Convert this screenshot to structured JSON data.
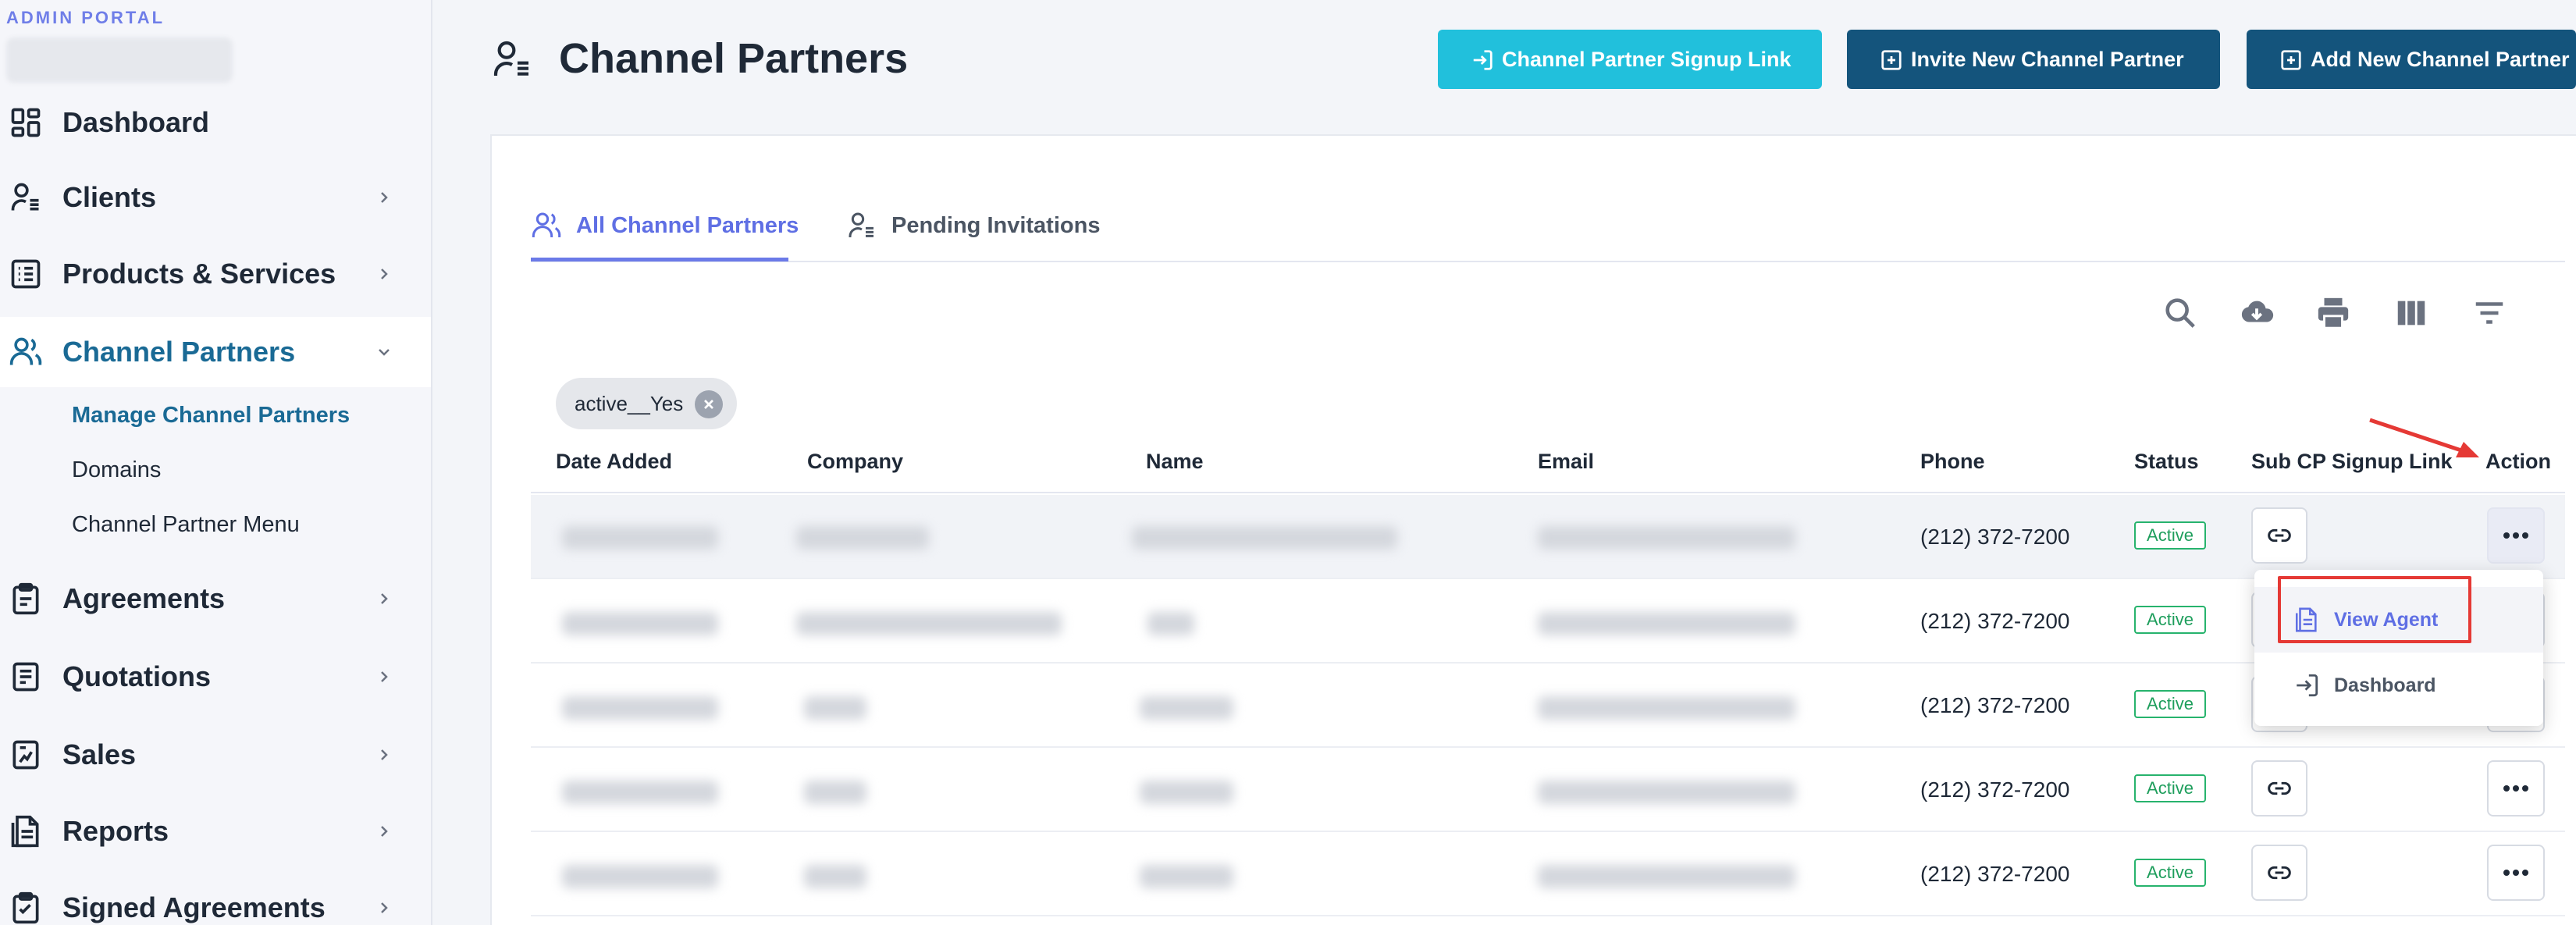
{
  "sidebar": {
    "brand": "ADMIN PORTAL",
    "items": [
      {
        "label": "Dashboard",
        "icon": "grid-icon"
      },
      {
        "label": "Clients",
        "icon": "user-list-icon"
      },
      {
        "label": "Products & Services",
        "icon": "list-icon"
      },
      {
        "label": "Channel Partners",
        "icon": "users-icon"
      },
      {
        "label": "Agreements",
        "icon": "clipboard-icon"
      },
      {
        "label": "Quotations",
        "icon": "receipt-icon"
      },
      {
        "label": "Sales",
        "icon": "sales-icon"
      },
      {
        "label": "Reports",
        "icon": "report-icon"
      },
      {
        "label": "Signed Agreements",
        "icon": "signed-icon"
      }
    ],
    "submenu": [
      "Manage Channel Partners",
      "Domains",
      "Channel Partner Menu"
    ]
  },
  "header": {
    "title": "Channel Partners",
    "buttons": {
      "signup_link": "Channel Partner Signup Link",
      "invite": "Invite New Channel Partner",
      "add": "Add New Channel Partner"
    }
  },
  "tabs": {
    "all": "All Channel Partners",
    "pending": "Pending Invitations"
  },
  "filter_chip": "active__Yes",
  "table": {
    "columns": [
      "Date Added",
      "Company",
      "Name",
      "Email",
      "Phone",
      "Status",
      "Sub CP Signup Link",
      "Action"
    ],
    "rows": [
      {
        "phone": "(212) 372-7200",
        "status": "Active"
      },
      {
        "phone": "(212) 372-7200",
        "status": "Active"
      },
      {
        "phone": "(212) 372-7200",
        "status": "Active"
      },
      {
        "phone": "(212) 372-7200",
        "status": "Active"
      },
      {
        "phone": "(212) 372-7200",
        "status": "Active"
      }
    ]
  },
  "action_menu": {
    "view_agent": "View Agent",
    "dashboard": "Dashboard"
  },
  "colors": {
    "accent": "#5f6fe4",
    "navy": "#14547c",
    "cyan": "#21c0dc",
    "active_green": "#27b36d",
    "annotation_red": "#e53935"
  }
}
